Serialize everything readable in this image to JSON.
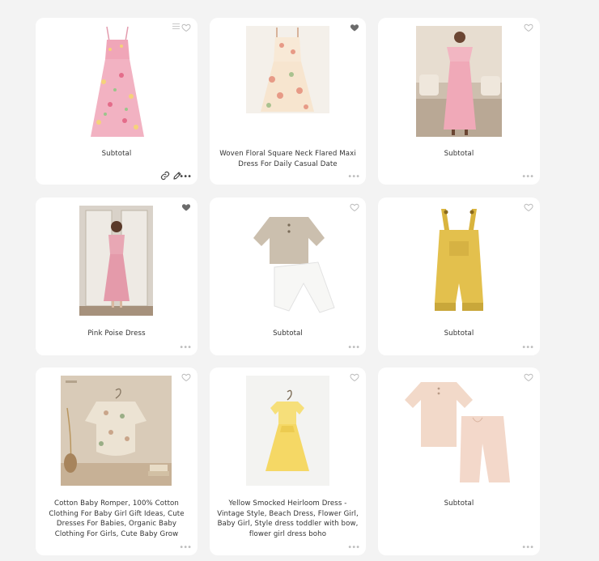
{
  "accent_colors": {
    "heart_filled": "#6b6b6b",
    "heart_outline": "#bcbcbc",
    "card_background": "#ffffff",
    "page_background": "#f3f3f3"
  },
  "icons": {
    "heart_outline": "heart-outline-icon",
    "heart_filled": "heart-filled-icon",
    "list": "list-icon",
    "link": "link-icon",
    "edit": "pencil-icon",
    "more": "more-dots-icon"
  },
  "products": [
    {
      "title": "Subtotal",
      "favorited": false,
      "image": "pink floral maxi dress with ruffle straps"
    },
    {
      "title": "Woven Floral Square Neck Flared Maxi Dress For Daily Casual Date",
      "favorited": true,
      "image": "cream floral square neck maxi dress"
    },
    {
      "title": "Subtotal",
      "favorited": false,
      "image": "woman in pink off-shoulder maxi dress"
    },
    {
      "title": "Pink Poise Dress",
      "favorited": true,
      "image": "woman in pink dress standing by door"
    },
    {
      "title": "Subtotal",
      "favorited": false,
      "image": "beige boys shirt and white pants set"
    },
    {
      "title": "Subtotal",
      "favorited": false,
      "image": "mustard corduroy baby overalls"
    },
    {
      "title": "Cotton Baby Romper, 100% Cotton Clothing For Baby Girl Gift Ideas, Cute Dresses For Babies, Organic Baby Clothing For Girls, Cute Baby Grow",
      "favorited": false,
      "image": "floral baby romper on hanger"
    },
    {
      "title": "Yellow Smocked Heirloom Dress - Vintage Style, Beach Dress, Flower Girl, Baby Girl, Style dress toddler with bow, flower girl dress boho",
      "favorited": false,
      "image": "yellow smocked toddler dress on hanger"
    },
    {
      "title": "Subtotal",
      "favorited": false,
      "image": "peach shirt and pants set"
    }
  ]
}
